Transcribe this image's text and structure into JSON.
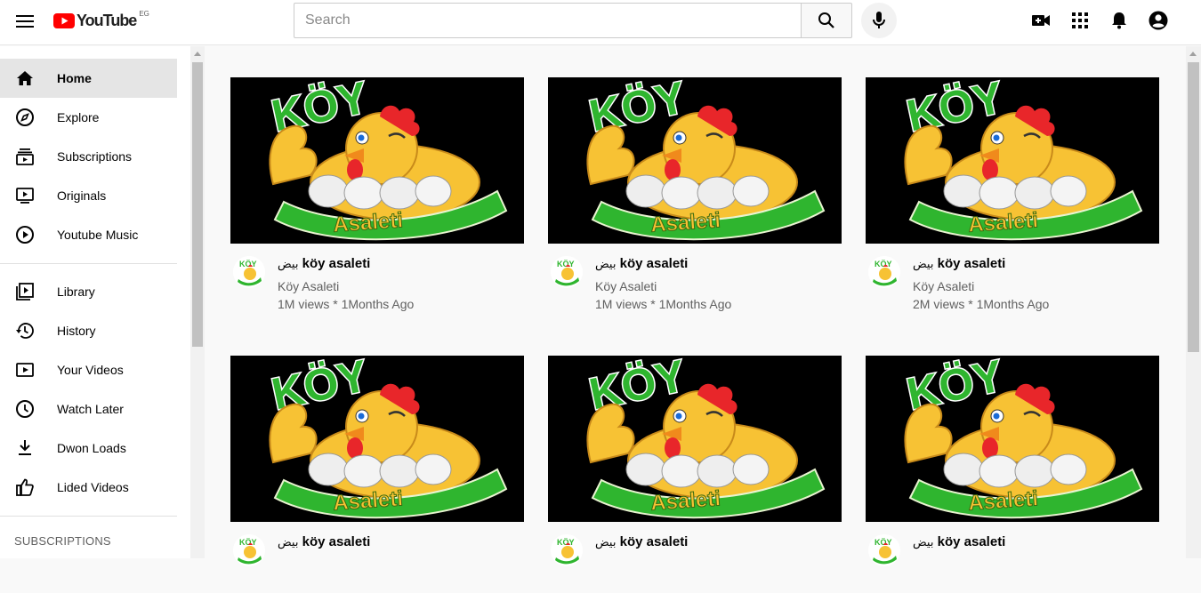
{
  "header": {
    "logo_text": "YouTube",
    "logo_country": "EG",
    "search_placeholder": "Search"
  },
  "sidebar": {
    "items": [
      {
        "label": "Home",
        "icon": "home-icon"
      },
      {
        "label": "Explore",
        "icon": "compass-icon"
      },
      {
        "label": "Subscriptions",
        "icon": "subscriptions-icon"
      },
      {
        "label": "Originals",
        "icon": "originals-icon"
      },
      {
        "label": "Youtube Music",
        "icon": "play-circle-icon"
      },
      {
        "label": "Library",
        "icon": "library-icon"
      },
      {
        "label": "History",
        "icon": "history-icon"
      },
      {
        "label": "Your Videos",
        "icon": "your-videos-icon"
      },
      {
        "label": "Watch Later",
        "icon": "clock-icon"
      },
      {
        "label": "Dwon Loads",
        "icon": "download-icon"
      },
      {
        "label": "Lided Videos",
        "icon": "thumbs-up-icon"
      }
    ],
    "subscriptions_heading": "SUBSCRIPTIONS"
  },
  "videos": [
    {
      "title_ar": "بيض",
      "title": "köy asaleti",
      "channel": "Köy Asaleti",
      "stats": "1M views * 1Months Ago",
      "thumb_top_text": "KÖY",
      "thumb_banner_text": "Asaleti"
    },
    {
      "title_ar": "بيض",
      "title": "köy asaleti",
      "channel": "Köy Asaleti",
      "stats": "1M views * 1Months Ago",
      "thumb_top_text": "KÖY",
      "thumb_banner_text": "Asaleti"
    },
    {
      "title_ar": "بيض",
      "title": "köy asaleti",
      "channel": "Köy Asaleti",
      "stats": "2M views * 1Months Ago",
      "thumb_top_text": "KÖY",
      "thumb_banner_text": "Asaleti"
    },
    {
      "title_ar": "بيض",
      "title": "köy asaleti",
      "channel": "",
      "stats": "",
      "thumb_top_text": "KÖY",
      "thumb_banner_text": "Asaleti"
    },
    {
      "title_ar": "بيض",
      "title": "köy asaleti",
      "channel": "",
      "stats": "",
      "thumb_top_text": "KÖY",
      "thumb_banner_text": "Asaleti"
    },
    {
      "title_ar": "بيض",
      "title": "köy asaleti",
      "channel": "",
      "stats": "",
      "thumb_top_text": "KÖY",
      "thumb_banner_text": "Asaleti"
    }
  ],
  "colors": {
    "brand_red": "#ff0000",
    "logo_green": "#2fb52f",
    "chick_yellow": "#f7c234",
    "comb_red": "#e8262a"
  }
}
